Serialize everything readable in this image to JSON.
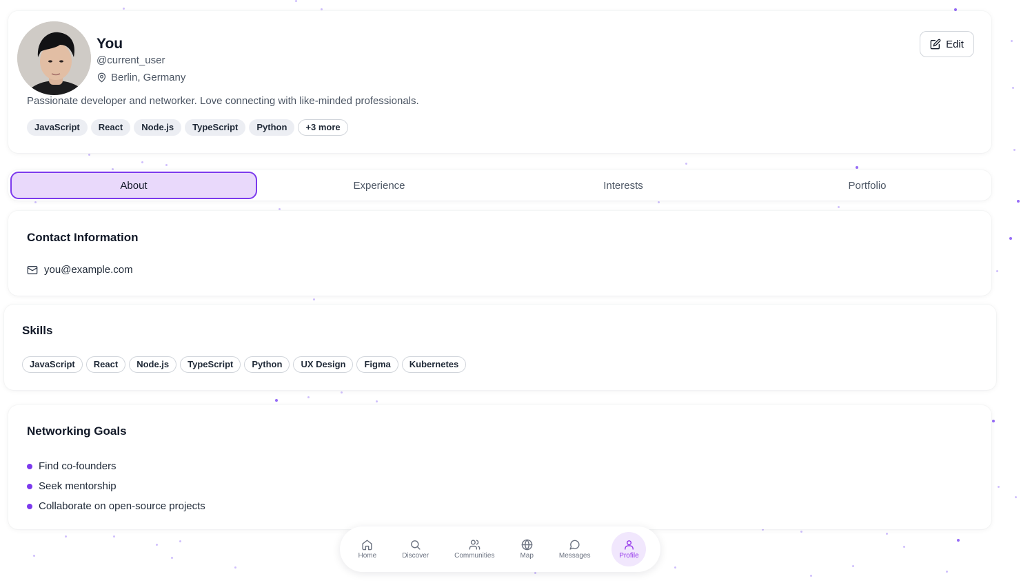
{
  "profile": {
    "name": "You",
    "handle": "@current_user",
    "location": "Berlin, Germany",
    "bio": "Passionate developer and networker. Love connecting with like-minded professionals.",
    "tags": [
      "JavaScript",
      "React",
      "Node.js",
      "TypeScript",
      "Python"
    ],
    "more_tags": "+3 more",
    "edit_label": "Edit"
  },
  "tabs": [
    {
      "label": "About",
      "active": true
    },
    {
      "label": "Experience",
      "active": false
    },
    {
      "label": "Interests",
      "active": false
    },
    {
      "label": "Portfolio",
      "active": false
    }
  ],
  "contact": {
    "title": "Contact Information",
    "email": "you@example.com"
  },
  "skills": {
    "title": "Skills",
    "items": [
      "JavaScript",
      "React",
      "Node.js",
      "TypeScript",
      "Python",
      "UX Design",
      "Figma",
      "Kubernetes"
    ]
  },
  "goals": {
    "title": "Networking Goals",
    "items": [
      "Find co-founders",
      "Seek mentorship",
      "Collaborate on open-source projects"
    ]
  },
  "nav": [
    {
      "label": "Home",
      "icon": "home-icon"
    },
    {
      "label": "Discover",
      "icon": "search-icon"
    },
    {
      "label": "Communities",
      "icon": "users-icon"
    },
    {
      "label": "Map",
      "icon": "globe-icon"
    },
    {
      "label": "Messages",
      "icon": "message-icon"
    },
    {
      "label": "Profile",
      "icon": "user-icon",
      "active": true
    }
  ],
  "colors": {
    "accent": "#7c3aed",
    "active_tab_bg": "#e9d9fb",
    "active_nav": "#9333ea"
  }
}
